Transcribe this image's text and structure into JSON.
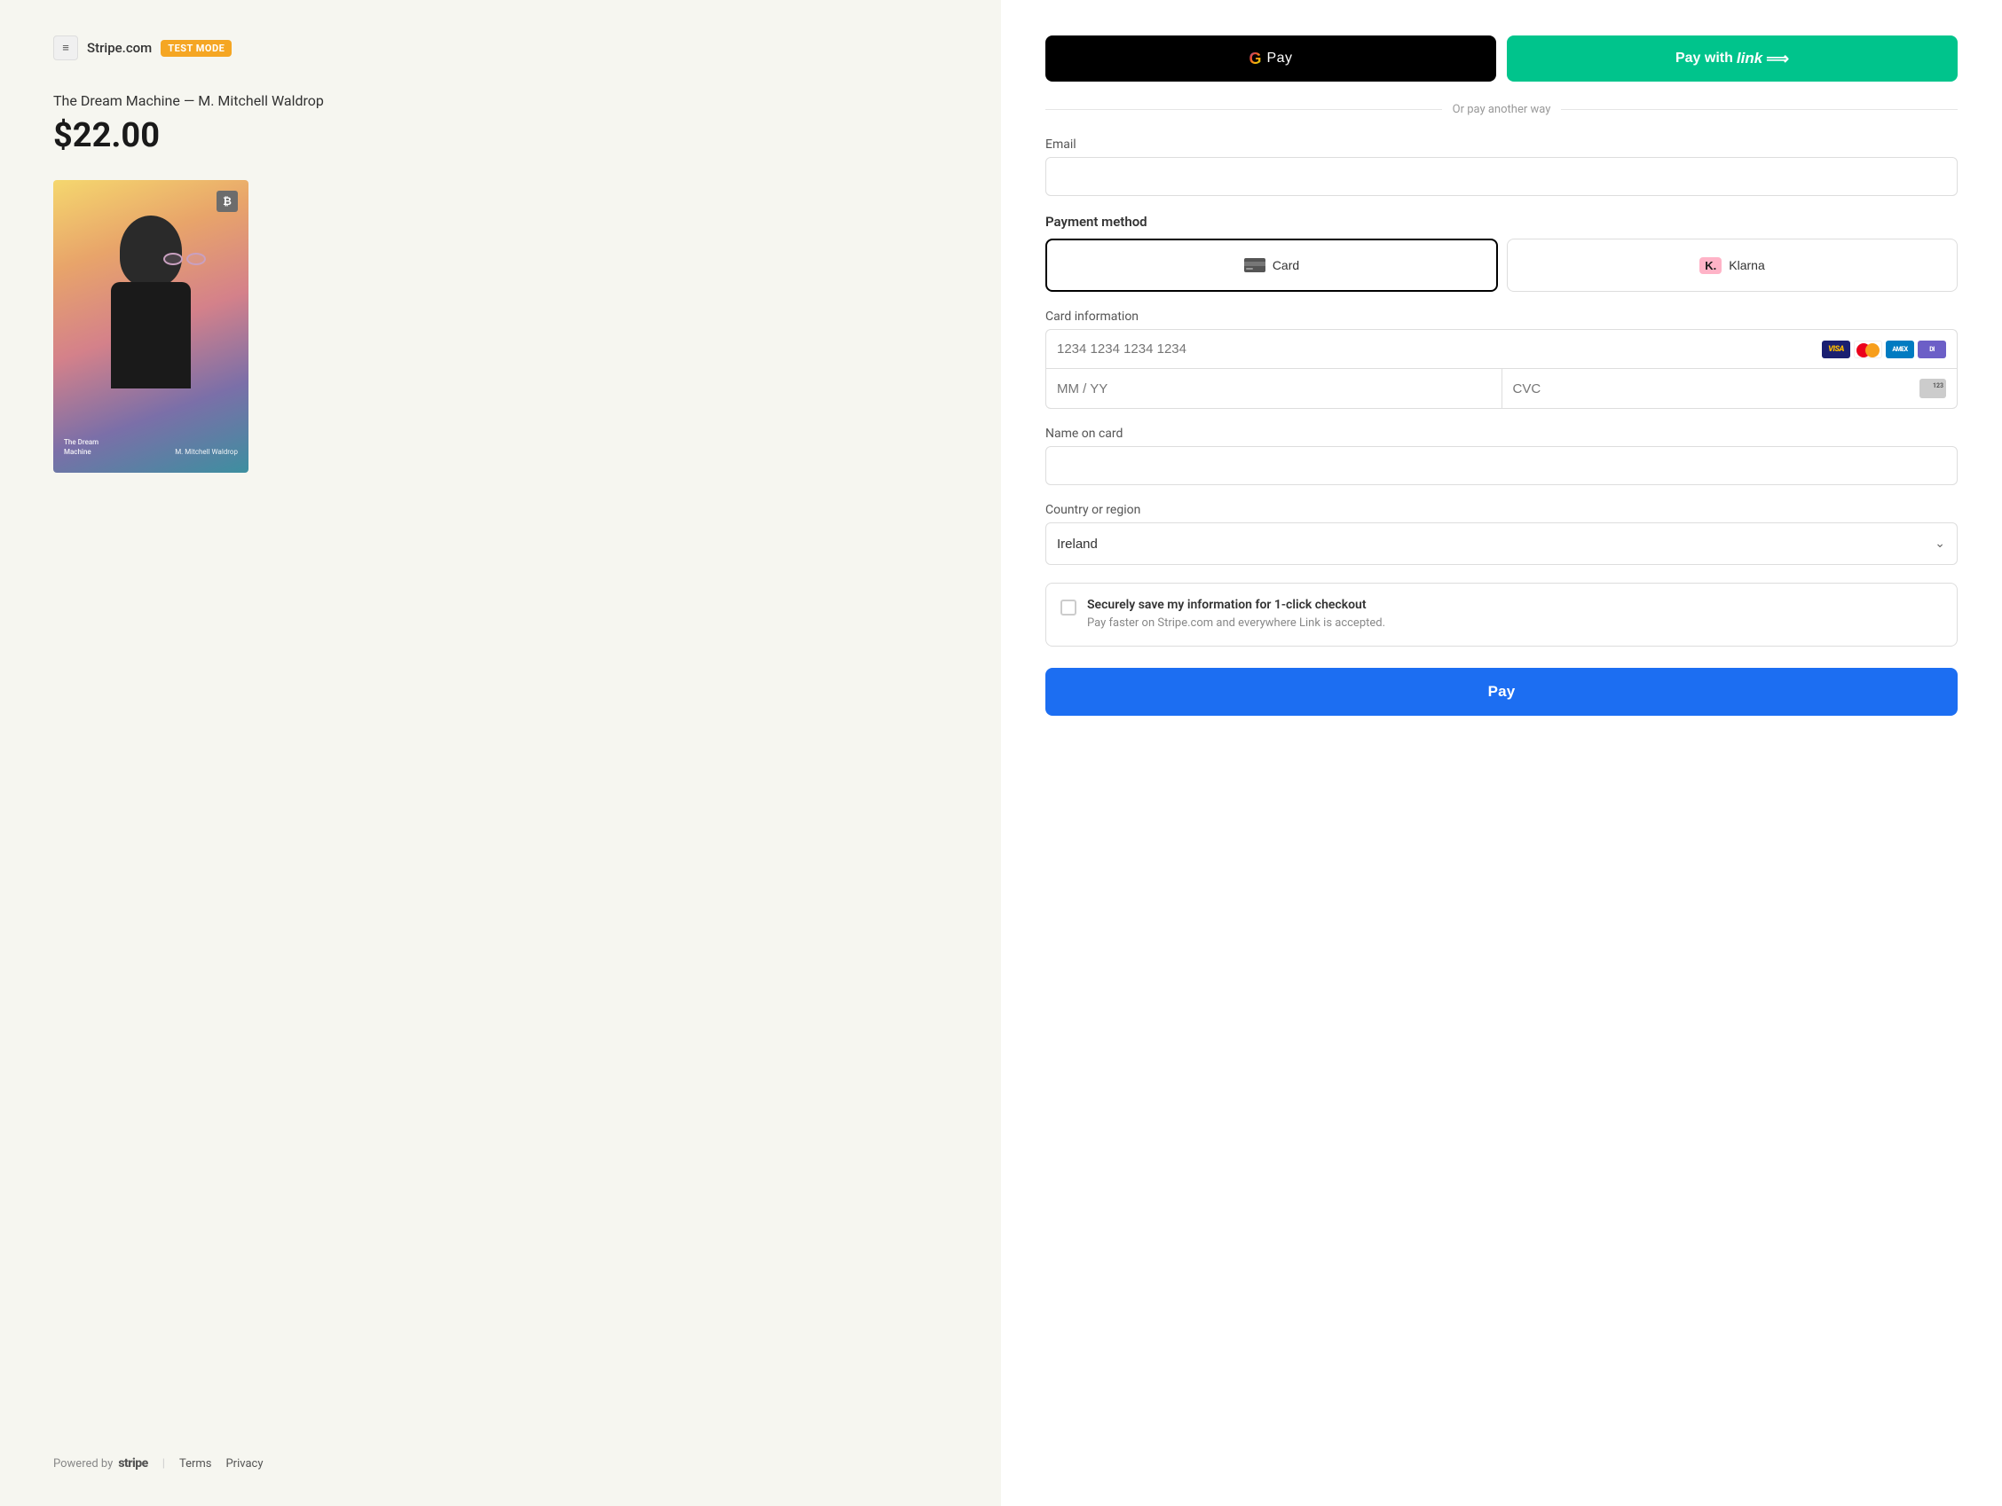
{
  "header": {
    "site_name": "Stripe.com",
    "test_mode_label": "TEST MODE",
    "stripe_icon": "≡"
  },
  "product": {
    "title": "The Dream Machine — M. Mitchell Waldrop",
    "price": "$22.00"
  },
  "book": {
    "title_line1": "The Dream",
    "title_line2": "Machine",
    "author": "M. Mitchell Waldrop",
    "btc_symbol": "₿"
  },
  "footer": {
    "powered_by": "Powered by",
    "stripe_brand": "stripe",
    "terms": "Terms",
    "privacy": "Privacy"
  },
  "payment": {
    "gpay_g": "G",
    "gpay_pay": "Pay",
    "link_pay_prefix": "Pay with",
    "link_word": "link",
    "link_arrow": "⟹",
    "divider_text": "Or pay another way"
  },
  "form": {
    "email_label": "Email",
    "email_placeholder": "",
    "payment_method_label": "Payment method",
    "card_option_label": "Card",
    "klarna_option_label": "Klarna",
    "card_info_label": "Card information",
    "card_number_placeholder": "1234 1234 1234 1234",
    "expiry_placeholder": "MM / YY",
    "cvc_placeholder": "CVC",
    "name_label": "Name on card",
    "name_placeholder": "",
    "country_label": "Country or region",
    "country_value": "Ireland",
    "save_title": "Securely save my information for 1-click checkout",
    "save_desc": "Pay faster on Stripe.com and everywhere Link is accepted.",
    "pay_button_label": "Pay"
  },
  "card_logos": {
    "visa": "VISA",
    "mastercard": "MC",
    "amex": "AMEX",
    "diners": "DI"
  }
}
